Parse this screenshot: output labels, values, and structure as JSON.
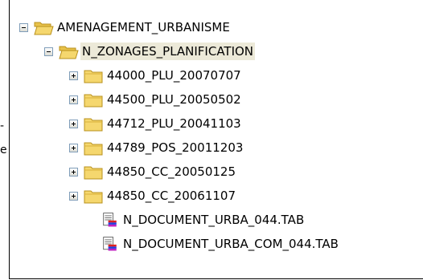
{
  "edge_marks": [
    "-",
    "e"
  ],
  "tree": {
    "root": {
      "label": "AMENAGEMENT_URBANISME",
      "toggle": "minus",
      "icon": "folder-open-icon"
    },
    "child": {
      "label": "N_ZONAGES_PLANIFICATION",
      "toggle": "minus",
      "icon": "folder-open-icon",
      "selected": true
    },
    "folders": [
      {
        "label": "44000_PLU_20070707",
        "toggle": "plus",
        "icon": "folder-closed-icon"
      },
      {
        "label": "44500_PLU_20050502",
        "toggle": "plus",
        "icon": "folder-closed-icon"
      },
      {
        "label": "44712_PLU_20041103",
        "toggle": "plus",
        "icon": "folder-closed-icon"
      },
      {
        "label": "44789_POS_20011203",
        "toggle": "plus",
        "icon": "folder-closed-icon"
      },
      {
        "label": "44850_CC_20050125",
        "toggle": "plus",
        "icon": "folder-closed-icon"
      },
      {
        "label": "44850_CC_20061107",
        "toggle": "plus",
        "icon": "folder-closed-icon"
      }
    ],
    "files": [
      {
        "label": "N_DOCUMENT_URBA_044.TAB",
        "icon": "table-file-icon"
      },
      {
        "label": "N_DOCUMENT_URBA_COM_044.TAB",
        "icon": "table-file-icon"
      }
    ]
  },
  "colors": {
    "folder_fill": "#f5d76e",
    "folder_edge": "#b8901c",
    "selection": "#ece9d8",
    "toggle_border": "#7f9db9"
  }
}
